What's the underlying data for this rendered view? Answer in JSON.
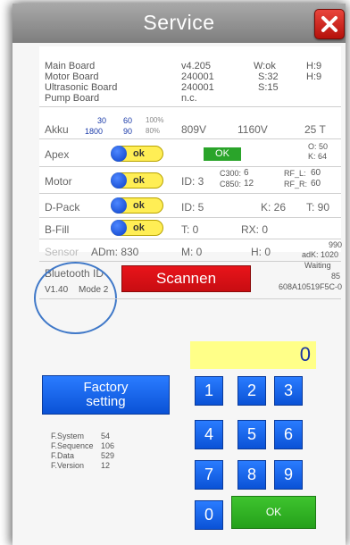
{
  "title": "Service",
  "boards": {
    "labels": [
      "Main Board",
      "Motor Board",
      "Ultrasonic Board",
      "Pump Board"
    ],
    "versions": [
      "v4.205",
      "240001",
      "240001",
      "n.c."
    ],
    "col3": [
      "W:ok",
      "S:32",
      "S:15",
      ""
    ],
    "col4": [
      "H:9",
      "H:9",
      "",
      ""
    ]
  },
  "akku": {
    "label": "Akku",
    "top": [
      "30",
      "60",
      "100%"
    ],
    "bottom": [
      "1800",
      "90",
      "80%"
    ],
    "v1": "809V",
    "v2": "1160V",
    "temp": "25 T"
  },
  "apex": {
    "label": "Apex",
    "toggle": "ok",
    "status": "OK",
    "o": "O:  50",
    "k": "K:  64"
  },
  "motor": {
    "label": "Motor",
    "toggle": "ok",
    "id": "ID: 3",
    "c300": "C300:",
    "c300_val": "6",
    "c850": "C850:",
    "c850_val": "12",
    "rfl": "RF_L:",
    "rfl_val": "60",
    "rfr": "RF_R:",
    "rfr_val": "60"
  },
  "dpack": {
    "label": "D-Pack",
    "toggle": "ok",
    "id": "ID: 5",
    "k": "K: 26",
    "t": "T: 90"
  },
  "bfill": {
    "label": "B-Fill",
    "toggle": "ok",
    "t": "T: 0",
    "rx": "RX: 0"
  },
  "sensor": {
    "label": "Sensor",
    "adm": "ADm: 830",
    "m": "M: 0",
    "h": "H: 0",
    "v990": "990",
    "adk": "adK: 1020"
  },
  "bluetooth": {
    "label": "Bluetooth ID",
    "version": "V1.40",
    "mode": "Mode 2",
    "button": "Scannen",
    "waiting": "Waiting",
    "count": "85",
    "address": "608A10519F5C-0"
  },
  "keypad": {
    "display": "0",
    "keys": [
      "1",
      "2",
      "3",
      "4",
      "5",
      "6",
      "7",
      "8",
      "9",
      "0"
    ],
    "ok": "OK"
  },
  "factory": {
    "line1": "Factory",
    "line2": "setting"
  },
  "fstats": [
    {
      "label": "F.System",
      "value": "54"
    },
    {
      "label": "F.Sequence",
      "value": "106"
    },
    {
      "label": "F.Data",
      "value": "529"
    },
    {
      "label": "F.Version",
      "value": "12"
    }
  ],
  "colors": {
    "toggle_yellow": "#ffee55",
    "button_blue": "#0a52d6",
    "ok_green": "#2aa42a",
    "scan_red": "#e8141a",
    "close_red": "#c8140c",
    "highlight_circle": "#3f78c8"
  }
}
